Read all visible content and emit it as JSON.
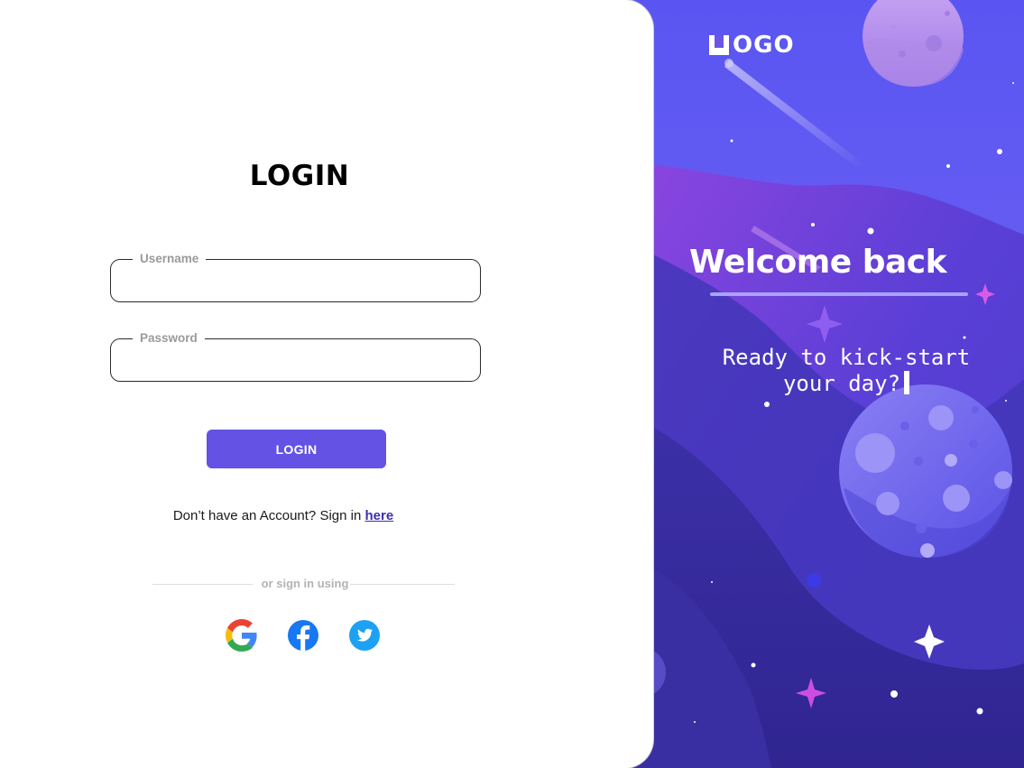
{
  "login_card": {
    "title": "LOGIN",
    "username_label": "Username",
    "username_value": "",
    "password_label": "Password",
    "password_value": "",
    "login_button": "LOGIN",
    "signup_text": "Don’t have an Account? Sign in ",
    "signup_link": "here",
    "divider_text": "or sign in using",
    "social_providers": [
      "google-icon",
      "facebook-icon",
      "twitter-icon"
    ]
  },
  "hero": {
    "logo_text": "OGO",
    "welcome_title": "Welcome back",
    "tagline_line1": "Ready to kick-start",
    "tagline_line2": "your day?"
  },
  "colors": {
    "accent": "#6352e3",
    "link": "#3d2fb0",
    "space_dark": "#2f248a",
    "space_light": "#5a4ff0"
  }
}
